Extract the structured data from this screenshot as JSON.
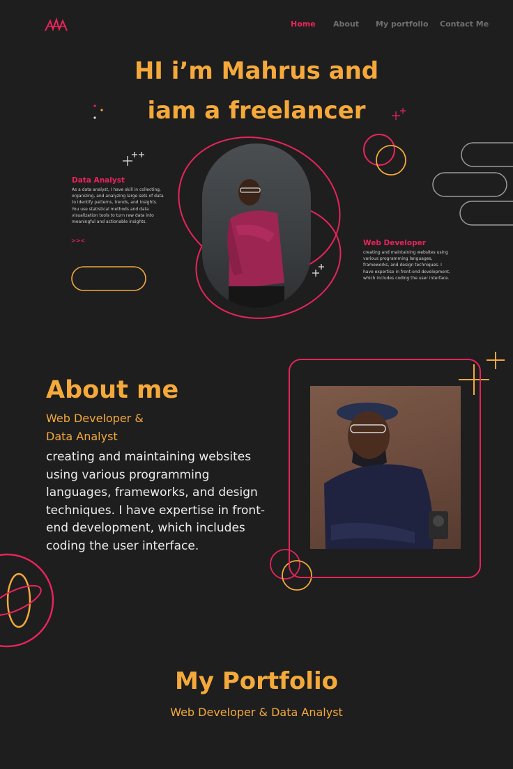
{
  "nav": {
    "items": [
      "Home",
      "About",
      "My portfolio",
      "Contact Me"
    ],
    "active": "Home"
  },
  "hero": {
    "title_line1": "HI i’m Mahrus and",
    "title_line2": "iam a freelancer"
  },
  "data_analyst": {
    "title": "Data Analyst",
    "text": "As a data analyst, I have skill in collecting, organizing, and analyzing large sets of data to identify patterns, trends, and insights. You use statistical methods and data visualization tools to turn raw data into meaningful and actionable insights.",
    "arrow": ">><"
  },
  "web_developer": {
    "title": "Web Developer",
    "text": "creating and maintaining websites using various programming languages, frameworks, and design techniques. I have expertise in front-end development, which includes coding the user interface."
  },
  "about": {
    "title": "About me",
    "subtitle_line1": "Web Developer &",
    "subtitle_line2": "Data Analyst",
    "body": "creating and maintaining websites using various programming languages, frameworks, and design techniques. I have expertise in front-end development, which includes coding the user interface."
  },
  "portfolio": {
    "title": "My Portfolio",
    "subtitle": "Web Developer & Data Analyst"
  },
  "colors": {
    "background": "#1e1e1f",
    "accent_orange": "#f5a93a",
    "accent_pink": "#e8245a",
    "nav_inactive": "#6f6f6f"
  },
  "icons": [
    "logo-icon",
    "sparkle-icon",
    "plus-icon",
    "arrow-icon"
  ]
}
